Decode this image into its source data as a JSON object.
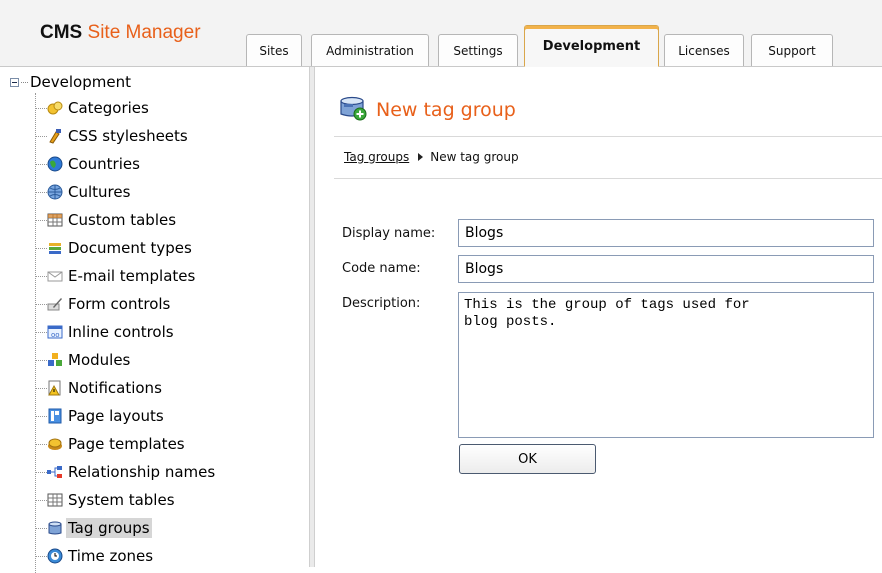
{
  "app": {
    "title_cms": "CMS",
    "title_rest": "Site Manager"
  },
  "tabs": [
    {
      "label": "Sites",
      "active": false
    },
    {
      "label": "Administration",
      "active": false
    },
    {
      "label": "Settings",
      "active": false
    },
    {
      "label": "Development",
      "active": true
    },
    {
      "label": "Licenses",
      "active": false
    },
    {
      "label": "Support",
      "active": false
    }
  ],
  "tree": {
    "root": "Development",
    "items": [
      {
        "label": "Categories",
        "icon": "categories-icon"
      },
      {
        "label": "CSS stylesheets",
        "icon": "css-stylesheets-icon"
      },
      {
        "label": "Countries",
        "icon": "countries-icon"
      },
      {
        "label": "Cultures",
        "icon": "cultures-icon"
      },
      {
        "label": "Custom tables",
        "icon": "custom-tables-icon"
      },
      {
        "label": "Document types",
        "icon": "document-types-icon"
      },
      {
        "label": "E-mail templates",
        "icon": "email-templates-icon"
      },
      {
        "label": "Form controls",
        "icon": "form-controls-icon"
      },
      {
        "label": "Inline controls",
        "icon": "inline-controls-icon"
      },
      {
        "label": "Modules",
        "icon": "modules-icon"
      },
      {
        "label": "Notifications",
        "icon": "notifications-icon"
      },
      {
        "label": "Page layouts",
        "icon": "page-layouts-icon"
      },
      {
        "label": "Page templates",
        "icon": "page-templates-icon"
      },
      {
        "label": "Relationship names",
        "icon": "relationship-names-icon"
      },
      {
        "label": "System tables",
        "icon": "system-tables-icon"
      },
      {
        "label": "Tag groups",
        "icon": "tag-groups-icon",
        "selected": true
      },
      {
        "label": "Time zones",
        "icon": "time-zones-icon"
      }
    ]
  },
  "main": {
    "title": "New tag group",
    "breadcrumb": {
      "link": "Tag groups",
      "current": "New tag group"
    },
    "form": {
      "display_name_label": "Display name:",
      "display_name_value": "Blogs",
      "code_name_label": "Code name:",
      "code_name_value": "Blogs",
      "description_label": "Description:",
      "description_value": "This is the group of tags used for\nblog posts.",
      "ok_label": "OK"
    }
  },
  "colors": {
    "accent": "#e8601a",
    "active_tab": "#f2b24a"
  }
}
